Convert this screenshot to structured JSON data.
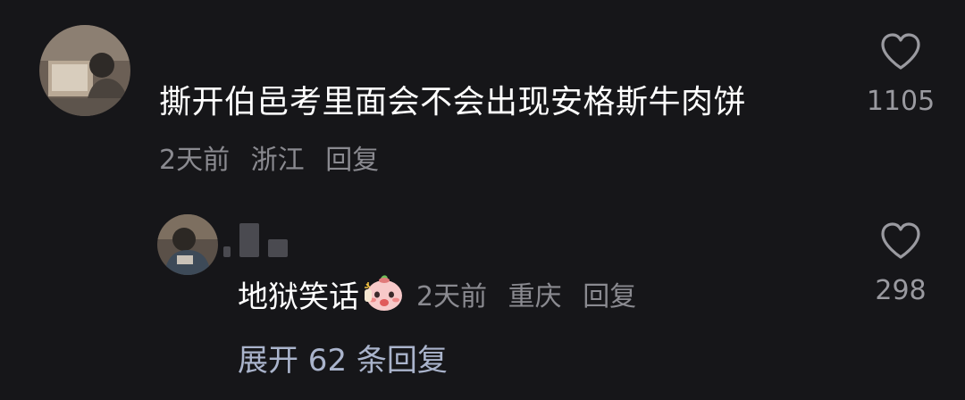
{
  "comment": {
    "text": "撕开伯邑考里面会不会出现安格斯牛肉饼",
    "time": "2天前",
    "location": "浙江",
    "reply_label": "回复",
    "likes": "1105",
    "avatar_icon": "user-avatar-photo"
  },
  "reply": {
    "text": "地狱笑话",
    "emoji_icon": "shy-face-emoji",
    "time": "2天前",
    "location": "重庆",
    "reply_label": "回复",
    "likes": "298",
    "avatar_icon": "user-avatar-photo"
  },
  "expand": {
    "label": "展开 62 条回复"
  },
  "colors": {
    "background": "#161619",
    "text_primary": "#ffffff",
    "text_secondary": "#8a8a90",
    "expand_link": "#aab4cc"
  }
}
